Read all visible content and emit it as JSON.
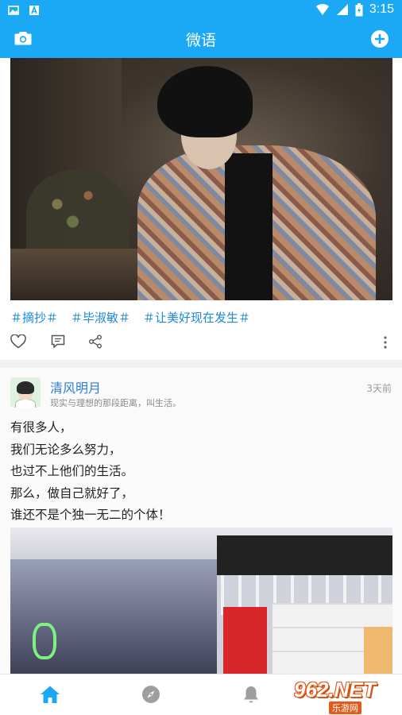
{
  "status_bar": {
    "time": "3:15"
  },
  "app_bar": {
    "title": "微语"
  },
  "post1": {
    "tags": [
      "＃摘抄＃",
      "＃毕淑敏＃",
      "＃让美好现在发生＃"
    ]
  },
  "post2": {
    "username": "清风明月",
    "signature": "现实与理想的那段距离，叫生活。",
    "time": "3天前",
    "lines": [
      "有很多人，",
      "我们无论多么努力，",
      "也过不上他们的生活。",
      "那么，做自己就好了，",
      "谁还不是个独一无二的个体！"
    ]
  },
  "bottom_nav": {
    "items": [
      "home-icon",
      "compass-icon",
      "bell-icon"
    ],
    "active_color": "#1ba9f5",
    "inactive_color": "#9e9e9e"
  },
  "watermark": {
    "logo": "962.NET",
    "sub": "乐游网"
  },
  "colors": {
    "primary": "#1ba9f5",
    "tag": "#1e88d6",
    "username": "#2d7fcf"
  }
}
